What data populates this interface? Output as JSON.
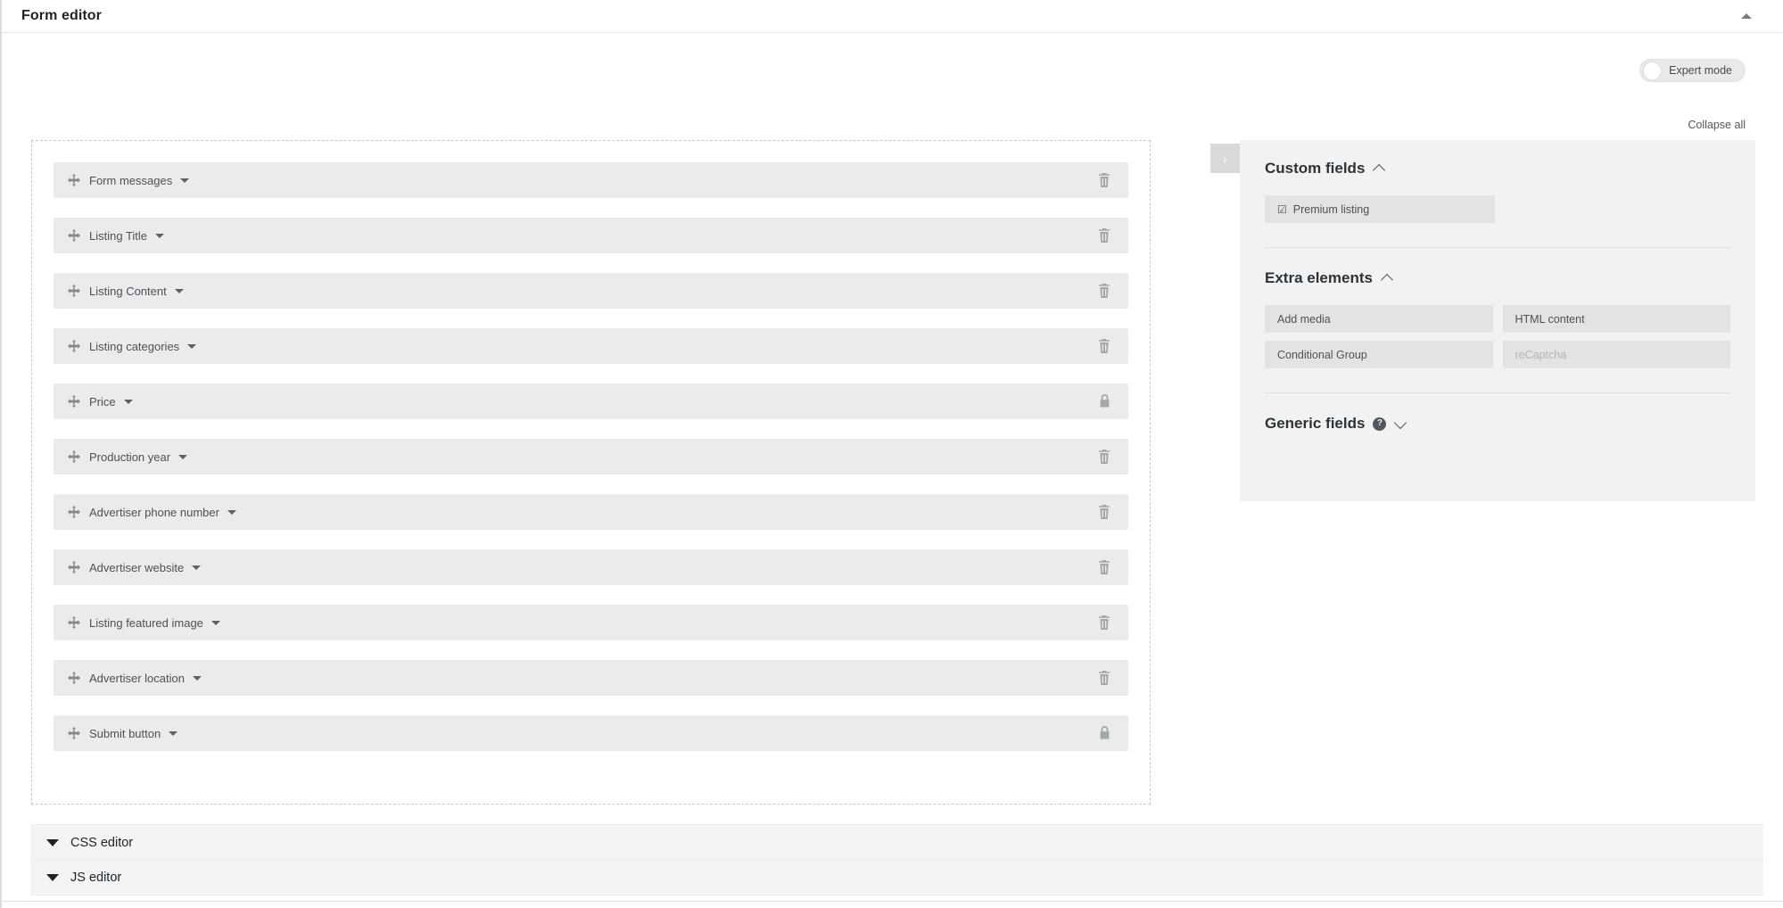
{
  "header": {
    "title": "Form editor",
    "collapse_toggle_icon": "caret-up-icon"
  },
  "toolbar": {
    "expert_mode_label": "Expert mode",
    "expert_mode_state": "off",
    "collapse_all_label": "Collapse all"
  },
  "builder": {
    "fields": [
      {
        "label": "Form messages",
        "action": "trash",
        "action_icon": "trash-icon"
      },
      {
        "label": "Listing Title",
        "action": "trash",
        "action_icon": "trash-icon"
      },
      {
        "label": "Listing Content",
        "action": "trash",
        "action_icon": "trash-icon"
      },
      {
        "label": "Listing categories",
        "action": "trash",
        "action_icon": "trash-icon"
      },
      {
        "label": "Price",
        "action": "lock",
        "action_icon": "lock-icon"
      },
      {
        "label": "Production year",
        "action": "trash",
        "action_icon": "trash-icon"
      },
      {
        "label": "Advertiser phone number",
        "action": "trash",
        "action_icon": "trash-icon"
      },
      {
        "label": "Advertiser website",
        "action": "trash",
        "action_icon": "trash-icon"
      },
      {
        "label": "Listing featured image",
        "action": "trash",
        "action_icon": "trash-icon"
      },
      {
        "label": "Advertiser location",
        "action": "trash",
        "action_icon": "trash-icon"
      },
      {
        "label": "Submit button",
        "action": "lock",
        "action_icon": "lock-icon"
      }
    ]
  },
  "side_panel": {
    "handle_icon": "chevron-right-icon",
    "sections": [
      {
        "title": "Custom fields",
        "state": "expanded",
        "chevron": "chevron-up-icon",
        "chips": [
          {
            "label": "Premium listing",
            "icon": "checkbox-checked-icon",
            "disabled": false
          }
        ]
      },
      {
        "title": "Extra elements",
        "state": "expanded",
        "chevron": "chevron-up-icon",
        "chips": [
          {
            "label": "Add media",
            "disabled": false
          },
          {
            "label": "HTML content",
            "disabled": false
          },
          {
            "label": "Conditional Group",
            "disabled": false
          },
          {
            "label": "reCaptcha",
            "disabled": true
          }
        ]
      },
      {
        "title": "Generic fields",
        "state": "collapsed",
        "chevron": "chevron-down-icon",
        "help_icon": "question-mark-icon",
        "help_label": "?"
      }
    ]
  },
  "editors": [
    {
      "label": "CSS editor",
      "state": "collapsed",
      "icon": "triangle-down-icon"
    },
    {
      "label": "JS editor",
      "state": "collapsed",
      "icon": "triangle-down-icon"
    }
  ],
  "colors": {
    "page_bg": "#ffffff",
    "row_bg": "#ebebeb",
    "panel_bg": "#f2f2f2",
    "chip_bg": "#e3e3e3",
    "text": "#4c5157",
    "heading": "#2c3338"
  }
}
